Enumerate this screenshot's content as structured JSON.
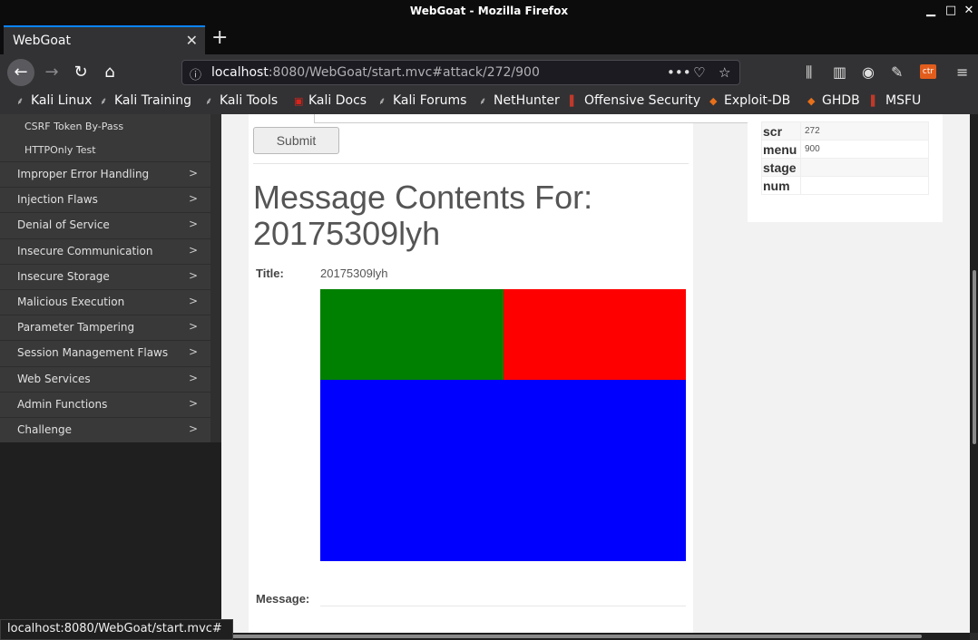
{
  "window": {
    "title": "WebGoat - Mozilla Firefox",
    "minimize": "▁",
    "maximize": "□",
    "close": "✕"
  },
  "tab": {
    "label": "WebGoat",
    "close": "✕",
    "new_tab": "+"
  },
  "nav": {
    "url_host": "localhost",
    "url_rest": ":8080/WebGoat/start.mvc#attack/272/900",
    "back": "←",
    "forward": "→",
    "reload": "↻",
    "home": "⌂",
    "page_actions": "•••",
    "pocket": "♡",
    "star": "☆",
    "library": "⫼",
    "sidebar_toggle": "▥",
    "menu": "≡"
  },
  "bookmarks": [
    {
      "label": "Kali Linux",
      "icon": "kali-dragon-icon"
    },
    {
      "label": "Kali Training",
      "icon": "kali-dragon-icon"
    },
    {
      "label": "Kali Tools",
      "icon": "kali-dragon-icon"
    },
    {
      "label": "Kali Docs",
      "icon": "docs-icon"
    },
    {
      "label": "Kali Forums",
      "icon": "kali-dragon-icon"
    },
    {
      "label": "NetHunter",
      "icon": "kali-dragon-icon"
    },
    {
      "label": "Offensive Security",
      "icon": "offsec-icon"
    },
    {
      "label": "Exploit-DB",
      "icon": "exploitdb-icon"
    },
    {
      "label": "GHDB",
      "icon": "exploitdb-icon"
    },
    {
      "label": "MSFU",
      "icon": "offsec-icon"
    }
  ],
  "sidebar": {
    "sub_items": [
      "CSRF Token By-Pass",
      "HTTPOnly Test"
    ],
    "items": [
      "Improper Error Handling",
      "Injection Flaws",
      "Denial of Service",
      "Insecure Communication",
      "Insecure Storage",
      "Malicious Execution",
      "Parameter Tampering",
      "Session Management Flaws",
      "Web Services",
      "Admin Functions",
      "Challenge"
    ],
    "chevron": ">"
  },
  "main": {
    "submit_label": "Submit",
    "heading": "Message Contents For: 20175309lyh",
    "title_label": "Title:",
    "title_value": "20175309lyh",
    "message_label": "Message:",
    "image_colors": {
      "top_left": "#008000",
      "top_right": "#ff0000",
      "bottom": "#0000ff"
    }
  },
  "params": [
    {
      "key": "scr",
      "value": "272"
    },
    {
      "key": "menu",
      "value": "900"
    },
    {
      "key": "stage",
      "value": ""
    },
    {
      "key": "num",
      "value": ""
    }
  ],
  "status_url": "localhost:8080/WebGoat/start.mvc#"
}
